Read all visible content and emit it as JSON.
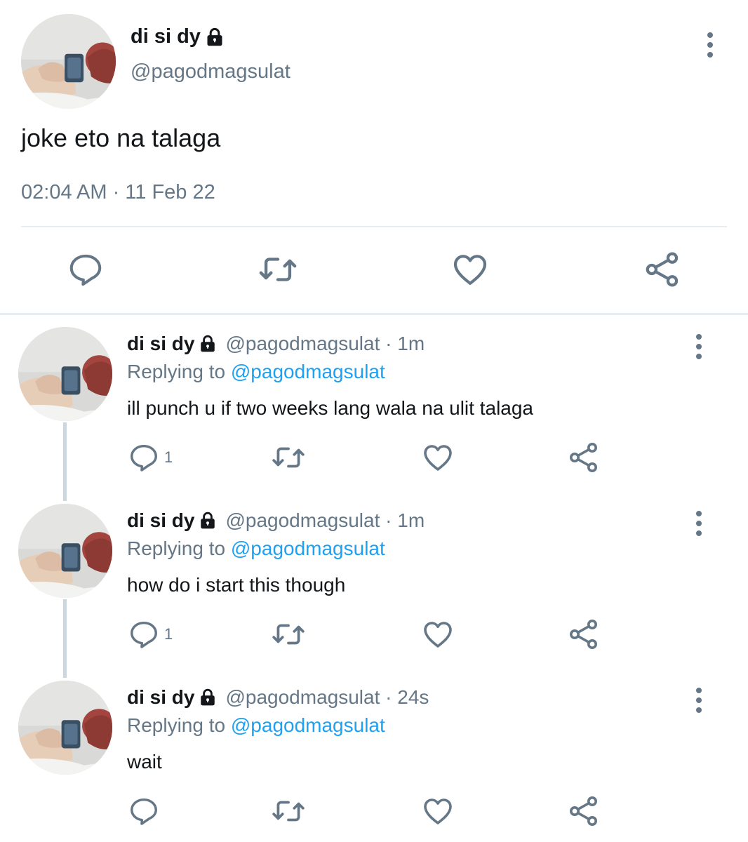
{
  "colors": {
    "text": "#14171a",
    "secondary": "#657786",
    "link": "#1da1f2",
    "divider": "#e6ecf0",
    "thread_line": "#ccd6dd"
  },
  "main_tweet": {
    "display_name": "di si dy",
    "handle": "@pagodmagsulat",
    "text": "joke eto na talaga",
    "timestamp": "02:04 AM · 11 Feb 22",
    "icons": [
      "lock-icon",
      "more-options-icon",
      "reply-icon",
      "retweet-icon",
      "like-icon",
      "share-icon"
    ]
  },
  "replies": [
    {
      "display_name": "di si dy",
      "handle_time": "@pagodmagsulat · 1m",
      "replying_prefix": "Replying to",
      "replying_to": "@pagodmagsulat",
      "text": "ill punch u if two weeks lang wala na ulit talaga",
      "reply_count": "1"
    },
    {
      "display_name": "di si dy",
      "handle_time": "@pagodmagsulat · 1m",
      "replying_prefix": "Replying to",
      "replying_to": "@pagodmagsulat",
      "text": "how do i start this though",
      "reply_count": "1"
    },
    {
      "display_name": "di si dy",
      "handle_time": "@pagodmagsulat · 24s",
      "replying_prefix": "Replying to",
      "replying_to": "@pagodmagsulat",
      "text": "wait",
      "reply_count": ""
    }
  ]
}
